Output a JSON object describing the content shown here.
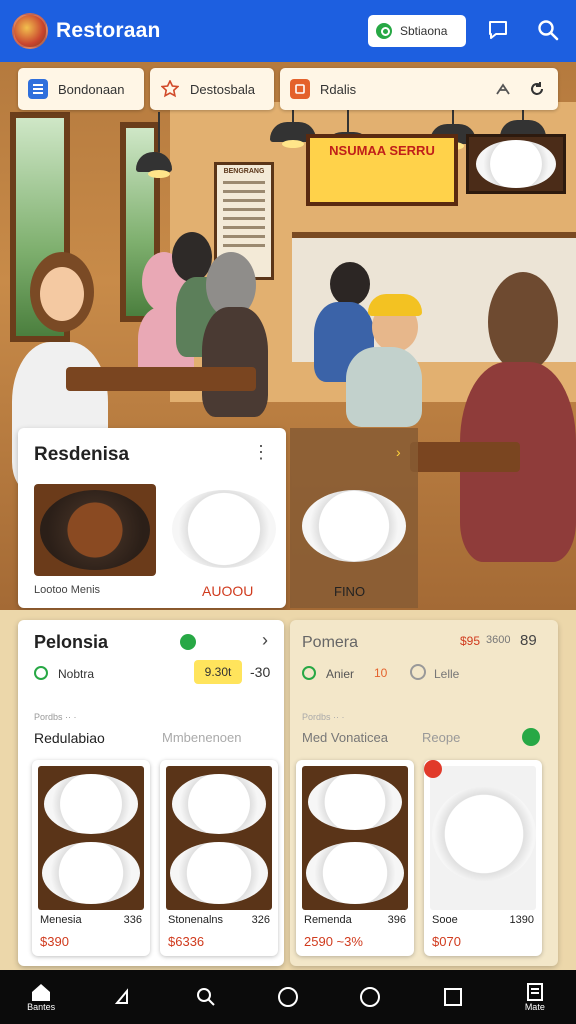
{
  "app": {
    "title": "Restoraan",
    "top_pill_label": "Sbtiaona"
  },
  "filter_chips": [
    {
      "label": "Bondonaan",
      "icon": "grid-icon"
    },
    {
      "label": "Destosbala",
      "icon": "star-icon"
    },
    {
      "label": "Rdalis",
      "icon": "tag-icon"
    }
  ],
  "scene": {
    "banner_text": "NSUMAA SERRU",
    "menu_board_title": "BENGRANG"
  },
  "featured_card": {
    "title": "Resdenisa",
    "items": [
      {
        "caption": "Lootoo Menis"
      },
      {
        "caption": "AUOOU"
      }
    ],
    "side_caption": "FINO"
  },
  "panel_left": {
    "title": "Pelonsia",
    "status_label": "Nobtra",
    "price_badge": "9.30t",
    "price_extra": "-30",
    "sub_small": "Pordbs ·· ·",
    "tab_active": "Redulabiao",
    "tab_inactive": "Mmbenenoen",
    "items": [
      {
        "name": "Menesia",
        "num": "336",
        "price": "$390"
      },
      {
        "name": "Stonenalns",
        "num": "326",
        "price": "$6336"
      }
    ]
  },
  "panel_right": {
    "title": "Pomera",
    "price_red": "$95",
    "price_small": "3600",
    "price_big": "89",
    "row_left": "Anier",
    "row_mid": "10",
    "row_right": "Lelle",
    "sub_small": "Pordbs ·· ·",
    "tab_active": "Med Vonaticea",
    "tab_inactive": "Reope",
    "items": [
      {
        "name": "Remenda",
        "num": "396",
        "price": "2590 ~3%"
      },
      {
        "name": "Sooe",
        "num": "1390",
        "price": "$070"
      }
    ]
  },
  "nav": [
    {
      "label": "Bantes",
      "icon": "home-icon"
    },
    {
      "label": "",
      "icon": "back-icon"
    },
    {
      "label": "",
      "icon": "search-icon"
    },
    {
      "label": "",
      "icon": "circle-icon"
    },
    {
      "label": "",
      "icon": "circle-icon"
    },
    {
      "label": "",
      "icon": "square-icon"
    },
    {
      "label": "Mate",
      "icon": "menu-icon"
    }
  ],
  "colors": {
    "topbar": "#1d5fe0",
    "price_red": "#d03b1e",
    "badge_yellow": "#ffe45c"
  }
}
